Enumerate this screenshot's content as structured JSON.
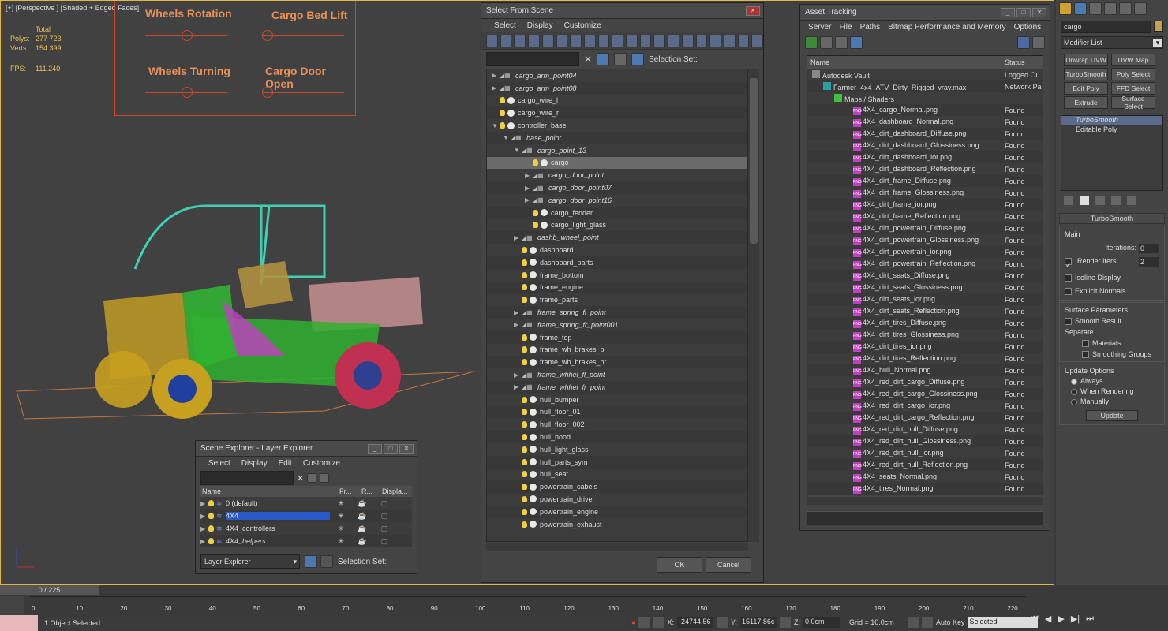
{
  "viewport": {
    "label": "[+] [Perspective ] [Shaded + Edged Faces]",
    "stats_header": "Total",
    "polys_label": "Polys:",
    "polys": "277 723",
    "verts_label": "Verts:",
    "verts": "154 399",
    "fps_label": "FPS:",
    "fps": "111.240"
  },
  "controls": {
    "wheels_rotation": "Wheels Rotation",
    "cargo_bed_lift": "Cargo Bed Lift",
    "wheels_turning": "Wheels Turning",
    "cargo_door_open": "Cargo Door Open"
  },
  "select_from_scene": {
    "title": "Select From Scene",
    "menu": [
      "Select",
      "Display",
      "Customize"
    ],
    "selection_set": "Selection Set:",
    "ok": "OK",
    "cancel": "Cancel",
    "items": [
      {
        "label": "cargo_arm_point04",
        "indent": 0,
        "italic": true,
        "arrow": "▶",
        "kind": "helper"
      },
      {
        "label": "cargo_arm_point08",
        "indent": 0,
        "italic": true,
        "arrow": "▶",
        "kind": "helper"
      },
      {
        "label": "cargo_wire_l",
        "indent": 0,
        "italic": false,
        "arrow": "",
        "kind": "object"
      },
      {
        "label": "cargo_wire_r",
        "indent": 0,
        "italic": false,
        "arrow": "",
        "kind": "object"
      },
      {
        "label": "controller_base",
        "indent": 0,
        "italic": false,
        "arrow": "▼",
        "kind": "object"
      },
      {
        "label": "base_point",
        "indent": 1,
        "italic": true,
        "arrow": "▼",
        "kind": "helper"
      },
      {
        "label": "cargo_point_13",
        "indent": 2,
        "italic": true,
        "arrow": "▼",
        "kind": "helper"
      },
      {
        "label": "cargo",
        "indent": 3,
        "italic": false,
        "arrow": "",
        "kind": "object",
        "selected": true
      },
      {
        "label": "cargo_door_point",
        "indent": 3,
        "italic": true,
        "arrow": "▶",
        "kind": "helper"
      },
      {
        "label": "cargo_door_point07",
        "indent": 3,
        "italic": true,
        "arrow": "▶",
        "kind": "helper"
      },
      {
        "label": "cargo_door_point16",
        "indent": 3,
        "italic": true,
        "arrow": "▶",
        "kind": "helper"
      },
      {
        "label": "cargo_fender",
        "indent": 3,
        "italic": false,
        "arrow": "",
        "kind": "object"
      },
      {
        "label": "cargo_light_glass",
        "indent": 3,
        "italic": false,
        "arrow": "",
        "kind": "object"
      },
      {
        "label": "dashb_wheel_point",
        "indent": 2,
        "italic": true,
        "arrow": "▶",
        "kind": "helper"
      },
      {
        "label": "dashboard",
        "indent": 2,
        "italic": false,
        "arrow": "",
        "kind": "object"
      },
      {
        "label": "dashboard_parts",
        "indent": 2,
        "italic": false,
        "arrow": "",
        "kind": "object"
      },
      {
        "label": "frame_bottom",
        "indent": 2,
        "italic": false,
        "arrow": "",
        "kind": "object"
      },
      {
        "label": "frame_engine",
        "indent": 2,
        "italic": false,
        "arrow": "",
        "kind": "object"
      },
      {
        "label": "frame_parts",
        "indent": 2,
        "italic": false,
        "arrow": "",
        "kind": "object"
      },
      {
        "label": "frame_spring_fl_point",
        "indent": 2,
        "italic": true,
        "arrow": "▶",
        "kind": "helper"
      },
      {
        "label": "frame_spring_fr_point001",
        "indent": 2,
        "italic": true,
        "arrow": "▶",
        "kind": "helper"
      },
      {
        "label": "frame_top",
        "indent": 2,
        "italic": false,
        "arrow": "",
        "kind": "object"
      },
      {
        "label": "frame_wh_brakes_bl",
        "indent": 2,
        "italic": false,
        "arrow": "",
        "kind": "object"
      },
      {
        "label": "frame_wh_brakes_br",
        "indent": 2,
        "italic": false,
        "arrow": "",
        "kind": "object"
      },
      {
        "label": "frame_whhel_fl_point",
        "indent": 2,
        "italic": true,
        "arrow": "▶",
        "kind": "helper"
      },
      {
        "label": "frame_whhel_fr_point",
        "indent": 2,
        "italic": true,
        "arrow": "▶",
        "kind": "helper"
      },
      {
        "label": "hull_bumper",
        "indent": 2,
        "italic": false,
        "arrow": "",
        "kind": "object"
      },
      {
        "label": "hull_floor_01",
        "indent": 2,
        "italic": false,
        "arrow": "",
        "kind": "object"
      },
      {
        "label": "hull_floor_002",
        "indent": 2,
        "italic": false,
        "arrow": "",
        "kind": "object"
      },
      {
        "label": "hull_hood",
        "indent": 2,
        "italic": false,
        "arrow": "",
        "kind": "object"
      },
      {
        "label": "hull_light_glass",
        "indent": 2,
        "italic": false,
        "arrow": "",
        "kind": "object"
      },
      {
        "label": "hull_parts_sym",
        "indent": 2,
        "italic": false,
        "arrow": "",
        "kind": "object"
      },
      {
        "label": "hull_seat",
        "indent": 2,
        "italic": false,
        "arrow": "",
        "kind": "object"
      },
      {
        "label": "powertrain_cabels",
        "indent": 2,
        "italic": false,
        "arrow": "",
        "kind": "object"
      },
      {
        "label": "powertrain_driver",
        "indent": 2,
        "italic": false,
        "arrow": "",
        "kind": "object"
      },
      {
        "label": "powertrain_engine",
        "indent": 2,
        "italic": false,
        "arrow": "",
        "kind": "object"
      },
      {
        "label": "powertrain_exhaust",
        "indent": 2,
        "italic": false,
        "arrow": "",
        "kind": "object"
      }
    ]
  },
  "scene_explorer": {
    "title": "Scene Explorer - Layer Explorer",
    "menu": [
      "Select",
      "Display",
      "Edit",
      "Customize"
    ],
    "col_name": "Name",
    "col_fr": "Fr...",
    "col_r": "R...",
    "col_disp": "Displa...",
    "footer_label": "Layer Explorer",
    "selection_set": "Selection Set:",
    "layers": [
      {
        "label": "0 (default)",
        "selected": false,
        "italic": false
      },
      {
        "label": "4X4",
        "selected": true,
        "italic": false
      },
      {
        "label": "4X4_controllers",
        "selected": false,
        "italic": false
      },
      {
        "label": "4X4_helpers",
        "selected": false,
        "italic": true
      }
    ]
  },
  "asset_tracking": {
    "title": "Asset Tracking",
    "menu": [
      "Server",
      "File",
      "Paths",
      "Bitmap Performance and Memory",
      "Options"
    ],
    "col_name": "Name",
    "col_status": "Status",
    "top_rows": [
      {
        "label": "Autodesk Vault",
        "status": "Logged Ou",
        "indent": 0
      },
      {
        "label": "Farmer_4x4_ATV_Dirty_Rigged_vray.max",
        "status": "Network Pa",
        "indent": 1
      },
      {
        "label": "Maps / Shaders",
        "status": "",
        "indent": 2
      }
    ],
    "status_found": "Found",
    "files": [
      "4X4_cargo_Normal.png",
      "4X4_dashboard_Normal.png",
      "4X4_dirt_dashboard_Diffuse.png",
      "4X4_dirt_dashboard_Glossiness.png",
      "4X4_dirt_dashboard_ior.png",
      "4X4_dirt_dashboard_Reflection.png",
      "4X4_dirt_frame_Diffuse.png",
      "4X4_dirt_frame_Glossiness.png",
      "4X4_dirt_frame_ior.png",
      "4X4_dirt_frame_Reflection.png",
      "4X4_dirt_powertrain_Diffuse.png",
      "4X4_dirt_powertrain_Glossiness.png",
      "4X4_dirt_powertrain_ior.png",
      "4X4_dirt_powertrain_Reflection.png",
      "4X4_dirt_seats_Diffuse.png",
      "4X4_dirt_seats_Glossiness.png",
      "4X4_dirt_seats_ior.png",
      "4X4_dirt_seats_Reflection.png",
      "4X4_dirt_tires_Diffuse.png",
      "4X4_dirt_tires_Glossiness.png",
      "4X4_dirt_tires_ior.png",
      "4X4_dirt_tires_Reflection.png",
      "4X4_hull_Normal.png",
      "4X4_red_dirt_cargo_Diffuse.png",
      "4X4_red_dirt_cargo_Glossiness.png",
      "4X4_red_dirt_cargo_ior.png",
      "4X4_red_dirt_cargo_Reflection.png",
      "4X4_red_dirt_hull_Diffuse.png",
      "4X4_red_dirt_hull_Glossiness.png",
      "4X4_red_dirt_hull_ior.png",
      "4X4_red_dirt_hull_Reflection.png",
      "4X4_seats_Normal.png",
      "4X4_tires_Normal.png"
    ]
  },
  "command_panel": {
    "search": "cargo",
    "modifier_list": "Modifier List",
    "buttons": [
      "Unwrap UVW",
      "UVW Map",
      "TurboSmooth",
      "Poly Select",
      "Edit Poly",
      "FFD Select",
      "Extrude",
      "Surface Select"
    ],
    "stack": [
      "TurboSmooth",
      "Editable Poly"
    ],
    "rollout": "TurboSmooth",
    "main": "Main",
    "iterations_label": "Iterations:",
    "iterations": "0",
    "render_iters_label": "Render Iters:",
    "render_iters": "2",
    "isoline": "Isoline Display",
    "explicit": "Explicit Normals",
    "surface_params": "Surface Parameters",
    "smooth_result": "Smooth Result",
    "separate": "Separate",
    "materials": "Materials",
    "smoothing_groups": "Smoothing Groups",
    "update_options": "Update Options",
    "always": "Always",
    "when_rendering": "When Rendering",
    "manually": "Manually",
    "update": "Update"
  },
  "timeline": {
    "frame": "0 / 225",
    "ticks": [
      "0",
      "10",
      "20",
      "30",
      "40",
      "50",
      "60",
      "70",
      "80",
      "90",
      "100",
      "110",
      "120",
      "130",
      "140",
      "150",
      "160",
      "170",
      "180",
      "190",
      "200",
      "210",
      "220"
    ]
  },
  "status": {
    "selected": "1 Object Selected",
    "x_label": "X:",
    "x": "-24744.56",
    "y_label": "Y:",
    "y": "15117.86c",
    "z_label": "Z:",
    "z": "0.0cm",
    "grid": "Grid = 10.0cm",
    "autokey": "Auto Key",
    "selected_dd": "Selected"
  }
}
